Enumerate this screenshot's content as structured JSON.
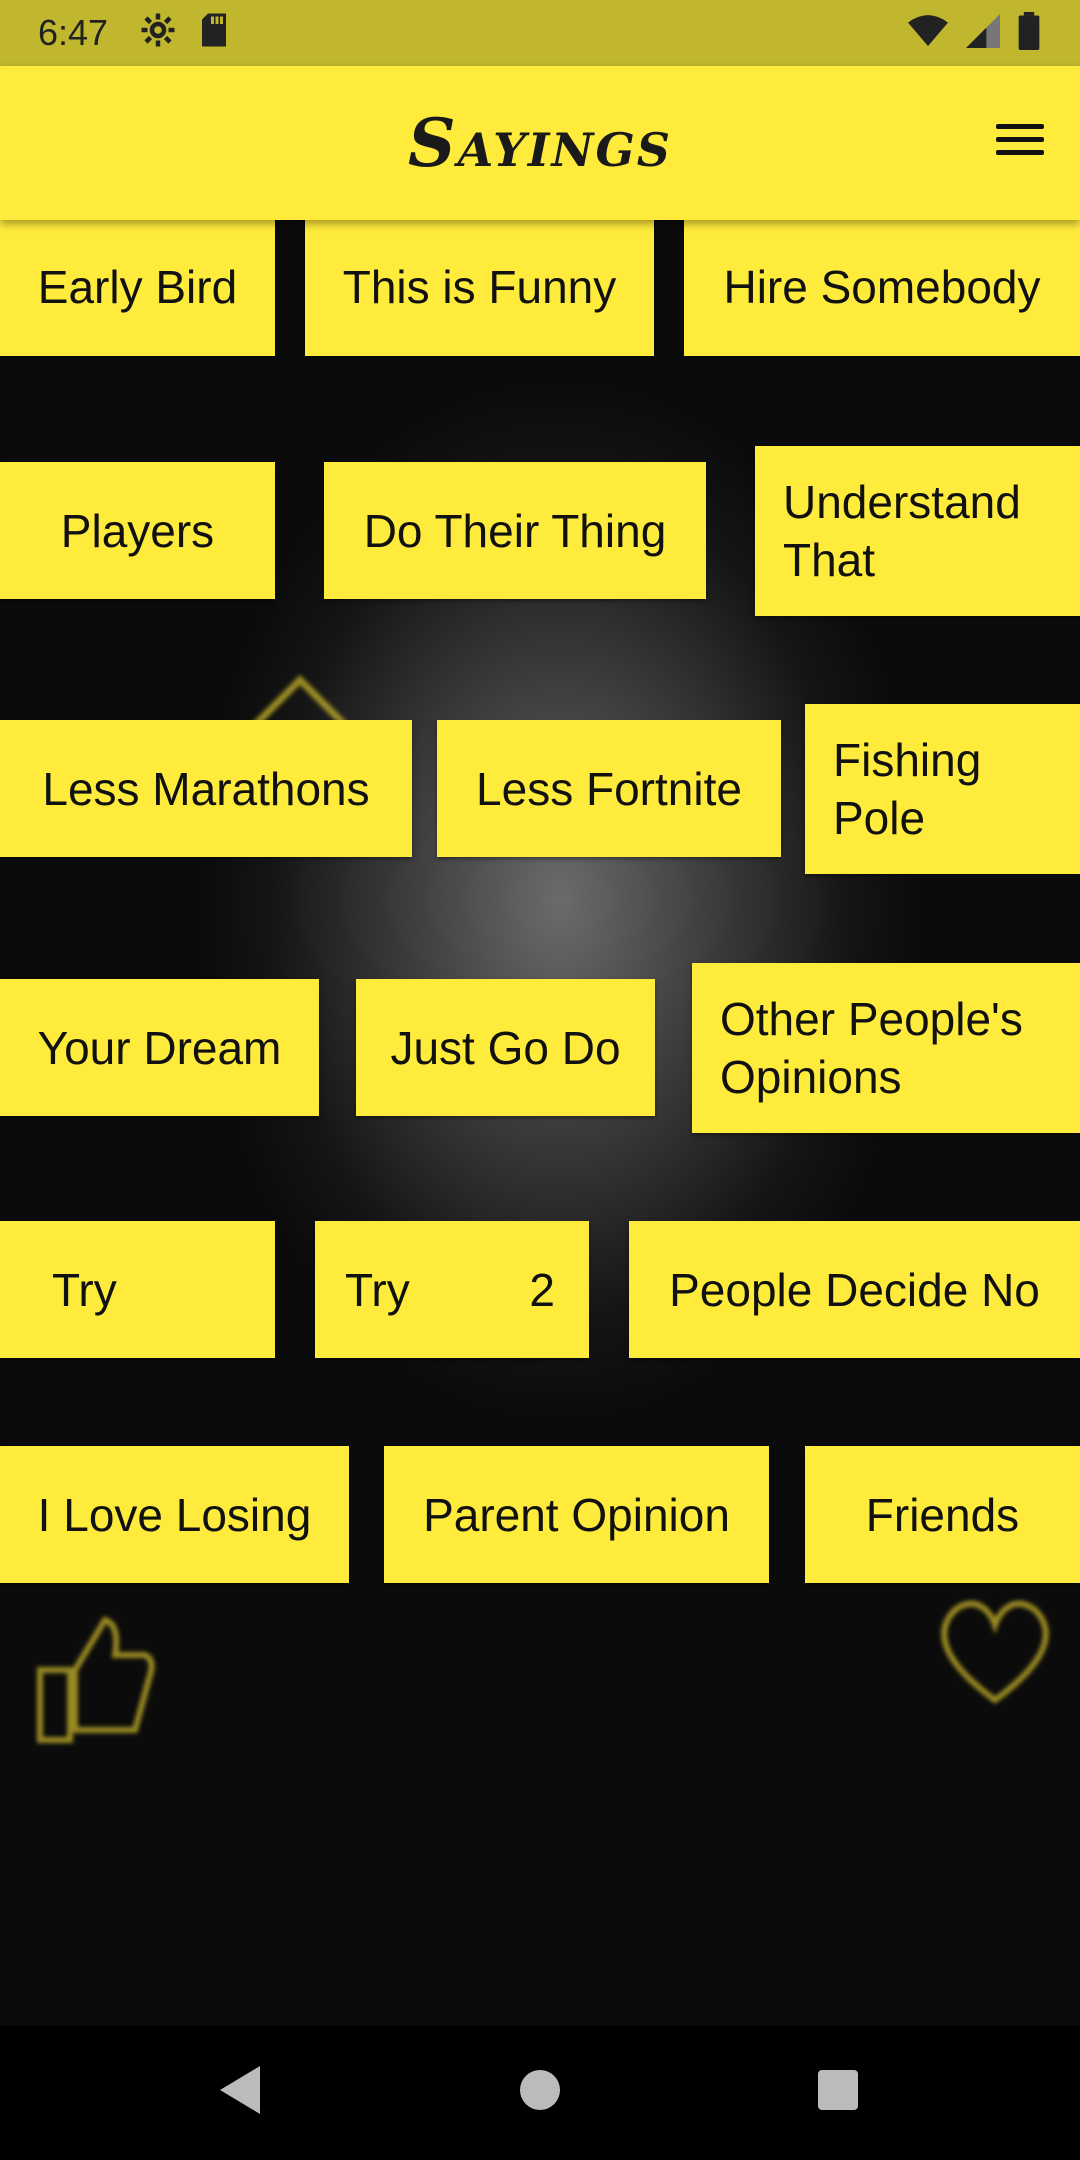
{
  "status_bar": {
    "time": "6:47",
    "left_icons": [
      "settings-icon",
      "sd-card-icon"
    ],
    "right_icons": [
      "wifi-icon",
      "signal-icon",
      "battery-icon"
    ]
  },
  "app_bar": {
    "title": "Sayings",
    "menu_icon": "hamburger-menu-icon"
  },
  "rows": [
    [
      "Early Bird",
      "This is Funny",
      "Hire Somebody"
    ],
    [
      "Players",
      "Do Their Thing",
      "Understand That"
    ],
    [
      "Less Marathons",
      "Less Fortnite",
      "Fishing Pole"
    ],
    [
      "Your Dream",
      "Just Go Do",
      "Other People's Opinions"
    ],
    [
      "Try",
      "Try",
      "2",
      "People Decide No"
    ],
    [
      "I Love Losing",
      "Parent Opinion",
      "Friends"
    ]
  ],
  "colors": {
    "accent": "#ffeb3b",
    "status_bar": "#c1b72f",
    "text": "#111111"
  },
  "nav_bar": {
    "icons": [
      "back-icon",
      "home-icon",
      "recents-icon"
    ]
  }
}
